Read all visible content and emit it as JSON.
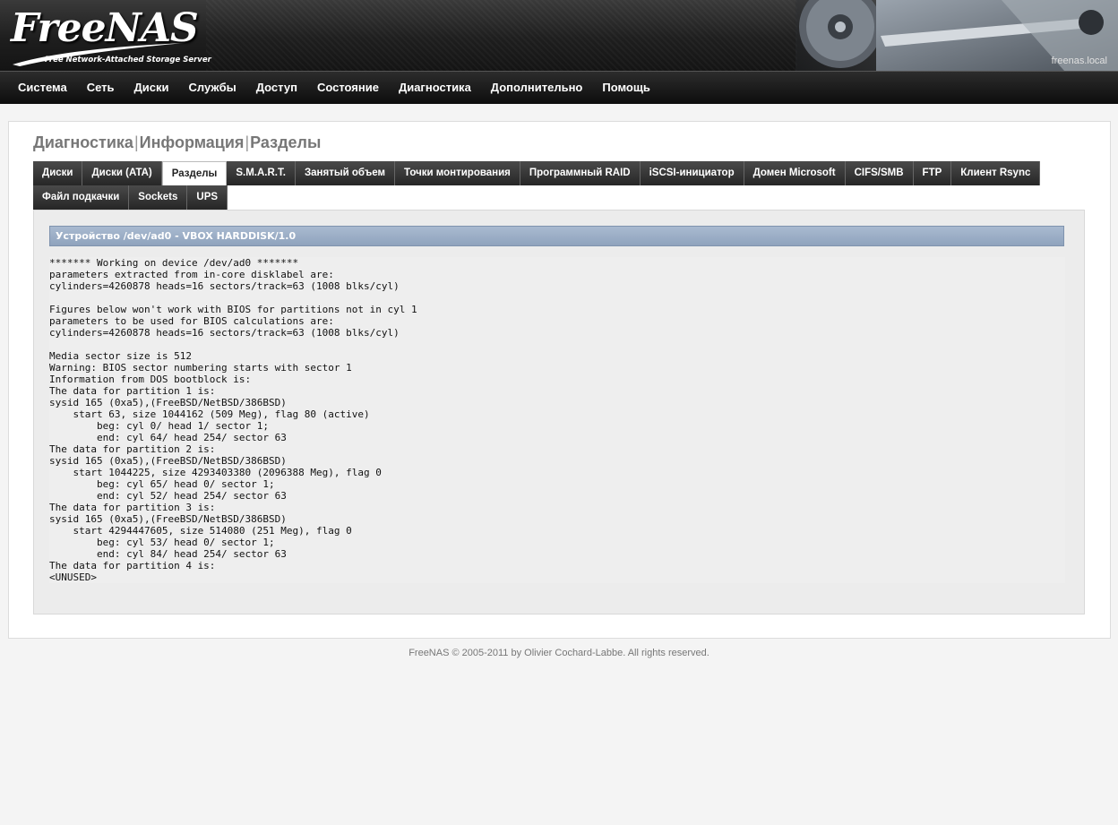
{
  "header": {
    "logo_text": "FreeNAS",
    "logo_subtitle": "Free Network-Attached Storage Server",
    "hostname": "freenas.local"
  },
  "nav": {
    "items": [
      {
        "label": "Система"
      },
      {
        "label": "Сеть"
      },
      {
        "label": "Диски"
      },
      {
        "label": "Службы"
      },
      {
        "label": "Доступ"
      },
      {
        "label": "Состояние"
      },
      {
        "label": "Диагностика"
      },
      {
        "label": "Дополнительно"
      },
      {
        "label": "Помощь"
      }
    ]
  },
  "page": {
    "breadcrumb": [
      "Диагностика",
      "Информация",
      "Разделы"
    ],
    "separator": "|"
  },
  "tabs": {
    "row1": [
      {
        "label": "Диски"
      },
      {
        "label": "Диски (ATA)"
      },
      {
        "label": "Разделы",
        "active": true
      },
      {
        "label": "S.M.A.R.T."
      },
      {
        "label": "Занятый объем"
      },
      {
        "label": "Точки монтирования"
      },
      {
        "label": "Программный RAID"
      },
      {
        "label": "iSCSI-инициатор"
      },
      {
        "label": "Домен Microsoft"
      },
      {
        "label": "CIFS/SMB"
      },
      {
        "label": "FTP"
      },
      {
        "label": "Клиент Rsync"
      }
    ],
    "row2": [
      {
        "label": "Файл подкачки"
      },
      {
        "label": "Sockets"
      },
      {
        "label": "UPS"
      }
    ]
  },
  "device": {
    "header": "Устройство /dev/ad0 - VBOX HARDDISK/1.0",
    "output": "******* Working on device /dev/ad0 *******\nparameters extracted from in-core disklabel are:\ncylinders=4260878 heads=16 sectors/track=63 (1008 blks/cyl)\n\nFigures below won't work with BIOS for partitions not in cyl 1\nparameters to be used for BIOS calculations are:\ncylinders=4260878 heads=16 sectors/track=63 (1008 blks/cyl)\n\nMedia sector size is 512\nWarning: BIOS sector numbering starts with sector 1\nInformation from DOS bootblock is:\nThe data for partition 1 is:\nsysid 165 (0xa5),(FreeBSD/NetBSD/386BSD)\n    start 63, size 1044162 (509 Meg), flag 80 (active)\n        beg: cyl 0/ head 1/ sector 1;\n        end: cyl 64/ head 254/ sector 63\nThe data for partition 2 is:\nsysid 165 (0xa5),(FreeBSD/NetBSD/386BSD)\n    start 1044225, size 4293403380 (2096388 Meg), flag 0\n        beg: cyl 65/ head 0/ sector 1;\n        end: cyl 52/ head 254/ sector 63\nThe data for partition 3 is:\nsysid 165 (0xa5),(FreeBSD/NetBSD/386BSD)\n    start 4294447605, size 514080 (251 Meg), flag 0\n        beg: cyl 53/ head 0/ sector 1;\n        end: cyl 84/ head 254/ sector 63\nThe data for partition 4 is:\n<UNUSED>"
  },
  "footer": {
    "text": "FreeNAS © 2005-2011 by Olivier Cochard-Labbe. All rights reserved."
  }
}
